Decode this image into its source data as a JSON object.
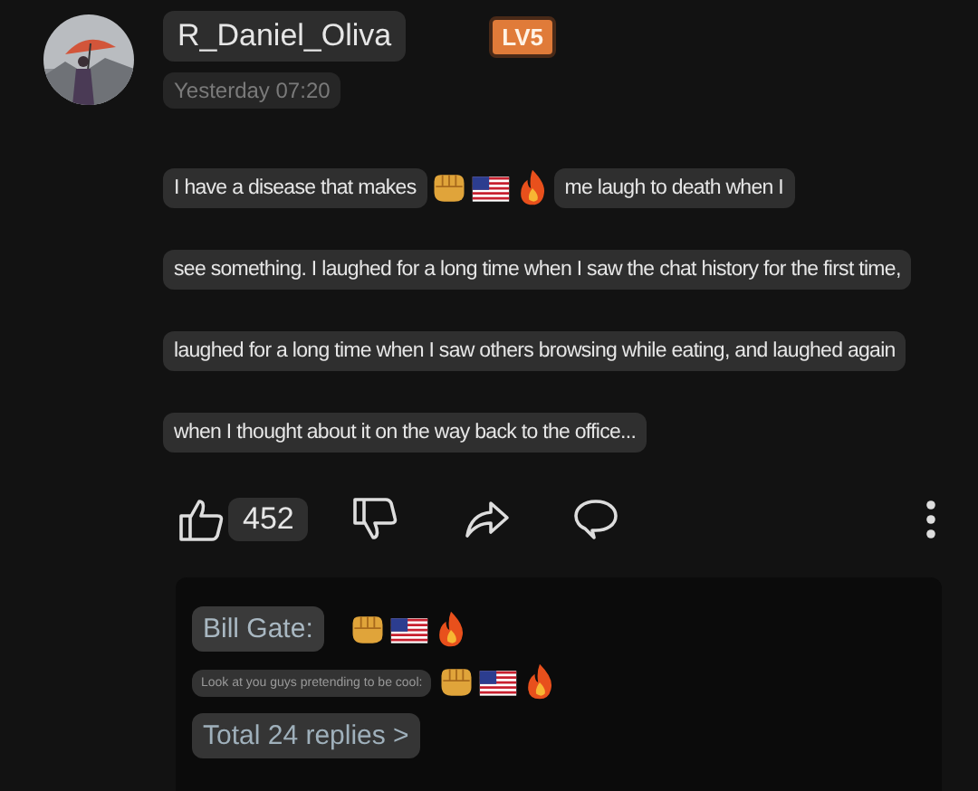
{
  "author": {
    "name": "R_Daniel_Oliva",
    "level_badge": "LV5",
    "time": "Yesterday 07:20"
  },
  "message": {
    "lines": [
      [
        {
          "kind": "text",
          "text": "I have a disease that makes"
        },
        {
          "kind": "fist"
        },
        {
          "kind": "flag"
        },
        {
          "kind": "flame"
        },
        {
          "kind": "text",
          "text": "me laugh to death when I"
        }
      ],
      [
        {
          "kind": "text",
          "text": "see something. I laughed for a long time when I saw the chat history for the first time,"
        }
      ],
      [
        {
          "kind": "text",
          "text": "laughed for a long time when I saw others browsing while eating, and laughed again"
        }
      ],
      [
        {
          "kind": "text",
          "text": "when I thought about it on the way back to the office..."
        }
      ]
    ]
  },
  "actions": {
    "like_count": "452"
  },
  "replies": {
    "items": [
      {
        "author": "Bill Gate:",
        "segments": [
          {
            "kind": "fist"
          },
          {
            "kind": "flag"
          },
          {
            "kind": "flame"
          }
        ]
      },
      {
        "segments": [
          {
            "kind": "text",
            "text": "Look at you guys pretending to be cool:"
          },
          {
            "kind": "fist"
          },
          {
            "kind": "flag"
          },
          {
            "kind": "flame"
          }
        ]
      }
    ],
    "total": "Total 24 replies >"
  }
}
